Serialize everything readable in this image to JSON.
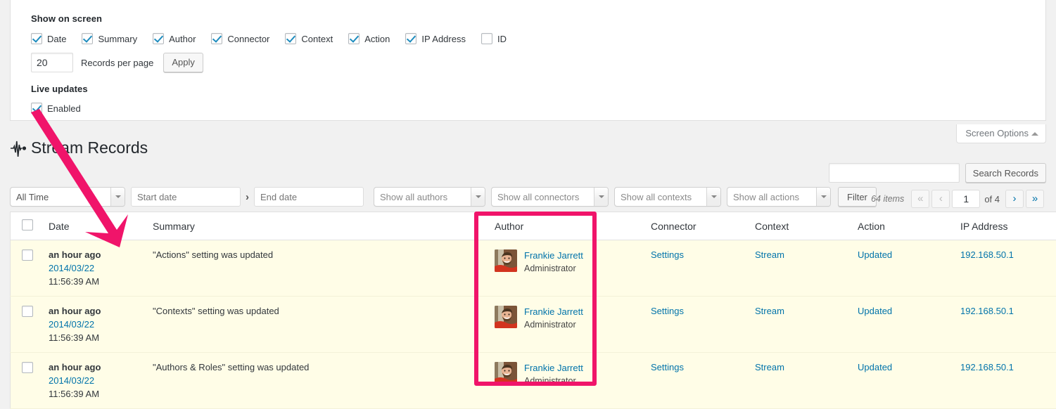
{
  "screen_options": {
    "tab_label": "Screen Options",
    "show_on_screen_heading": "Show on screen",
    "columns": [
      {
        "label": "Date",
        "checked": true
      },
      {
        "label": "Summary",
        "checked": true
      },
      {
        "label": "Author",
        "checked": true
      },
      {
        "label": "Connector",
        "checked": true
      },
      {
        "label": "Context",
        "checked": true
      },
      {
        "label": "Action",
        "checked": true
      },
      {
        "label": "IP Address",
        "checked": true
      },
      {
        "label": "ID",
        "checked": false
      }
    ],
    "records_per_page_value": "20",
    "records_per_page_label": "Records per page",
    "apply_label": "Apply",
    "live_updates_heading": "Live updates",
    "live_updates_label": "Enabled",
    "live_updates_checked": true
  },
  "page": {
    "title": "Stream Records",
    "title_icon": "stream-waveform-icon"
  },
  "search": {
    "value": "",
    "placeholder": "",
    "button_label": "Search Records"
  },
  "filters": {
    "date_range": "All Time",
    "start_date_placeholder": "Start date",
    "end_date_placeholder": "End date",
    "date_separator": "›",
    "authors": "Show all authors",
    "connectors": "Show all connectors",
    "contexts": "Show all contexts",
    "actions": "Show all actions",
    "filter_button": "Filter"
  },
  "pagination": {
    "items_text": "64 items",
    "first_label": "«",
    "prev_label": "‹",
    "current_page": "1",
    "total_text": "of 4",
    "next_label": "›",
    "last_label": "»"
  },
  "table": {
    "headers": {
      "date": "Date",
      "summary": "Summary",
      "author": "Author",
      "connector": "Connector",
      "context": "Context",
      "action": "Action",
      "ip_address": "IP Address"
    },
    "rows": [
      {
        "date_relative": "an hour ago",
        "date_ymd": "2014/03/22",
        "date_time": "11:56:39 AM",
        "summary": "\"Actions\" setting was updated",
        "author_name": "Frankie Jarrett",
        "author_role": "Administrator",
        "connector": "Settings",
        "context": "Stream",
        "action": "Updated",
        "ip_address": "192.168.50.1"
      },
      {
        "date_relative": "an hour ago",
        "date_ymd": "2014/03/22",
        "date_time": "11:56:39 AM",
        "summary": "\"Contexts\" setting was updated",
        "author_name": "Frankie Jarrett",
        "author_role": "Administrator",
        "connector": "Settings",
        "context": "Stream",
        "action": "Updated",
        "ip_address": "192.168.50.1"
      },
      {
        "date_relative": "an hour ago",
        "date_ymd": "2014/03/22",
        "date_time": "11:56:39 AM",
        "summary": "\"Authors & Roles\" setting was updated",
        "author_name": "Frankie Jarrett",
        "author_role": "Administrator",
        "connector": "Settings",
        "context": "Stream",
        "action": "Updated",
        "ip_address": "192.168.50.1"
      }
    ]
  },
  "annotations": {
    "highlight_color": "#f0146a",
    "arrow_color": "#f0146a",
    "arrow_from": "live-updates-enabled-checkbox",
    "arrow_to": "first-record-row",
    "highlight_target": "author-column"
  },
  "colors": {
    "link": "#0073aa",
    "row_background": "#fffde7",
    "page_background": "#f1f1f1"
  }
}
